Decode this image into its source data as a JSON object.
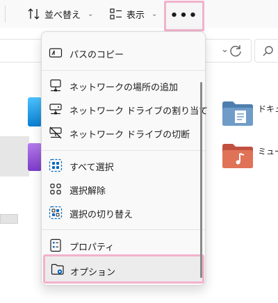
{
  "toolbar": {
    "sort_label": "並べ替え",
    "view_label": "表示",
    "more_label": "•••"
  },
  "background": {
    "folder_documents_label": "ドキュ",
    "folder_music_label": "ミュー"
  },
  "menu": {
    "items": [
      {
        "label": "パスのコピー",
        "icon": "copy-path-icon"
      },
      {
        "label": "ネットワークの場所の追加",
        "icon": "network-location-icon"
      },
      {
        "label": "ネットワーク ドライブの割り当て",
        "icon": "map-network-drive-icon"
      },
      {
        "label": "ネットワーク ドライブの切断",
        "icon": "disconnect-network-drive-icon"
      },
      {
        "label": "すべて選択",
        "icon": "select-all-icon"
      },
      {
        "label": "選択解除",
        "icon": "select-none-icon"
      },
      {
        "label": "選択の切り替え",
        "icon": "invert-selection-icon"
      },
      {
        "label": "プロパティ",
        "icon": "properties-icon"
      },
      {
        "label": "オプション",
        "icon": "options-icon"
      }
    ]
  },
  "colors": {
    "highlight": "#f2b2cc",
    "accent": "#0067c0"
  }
}
